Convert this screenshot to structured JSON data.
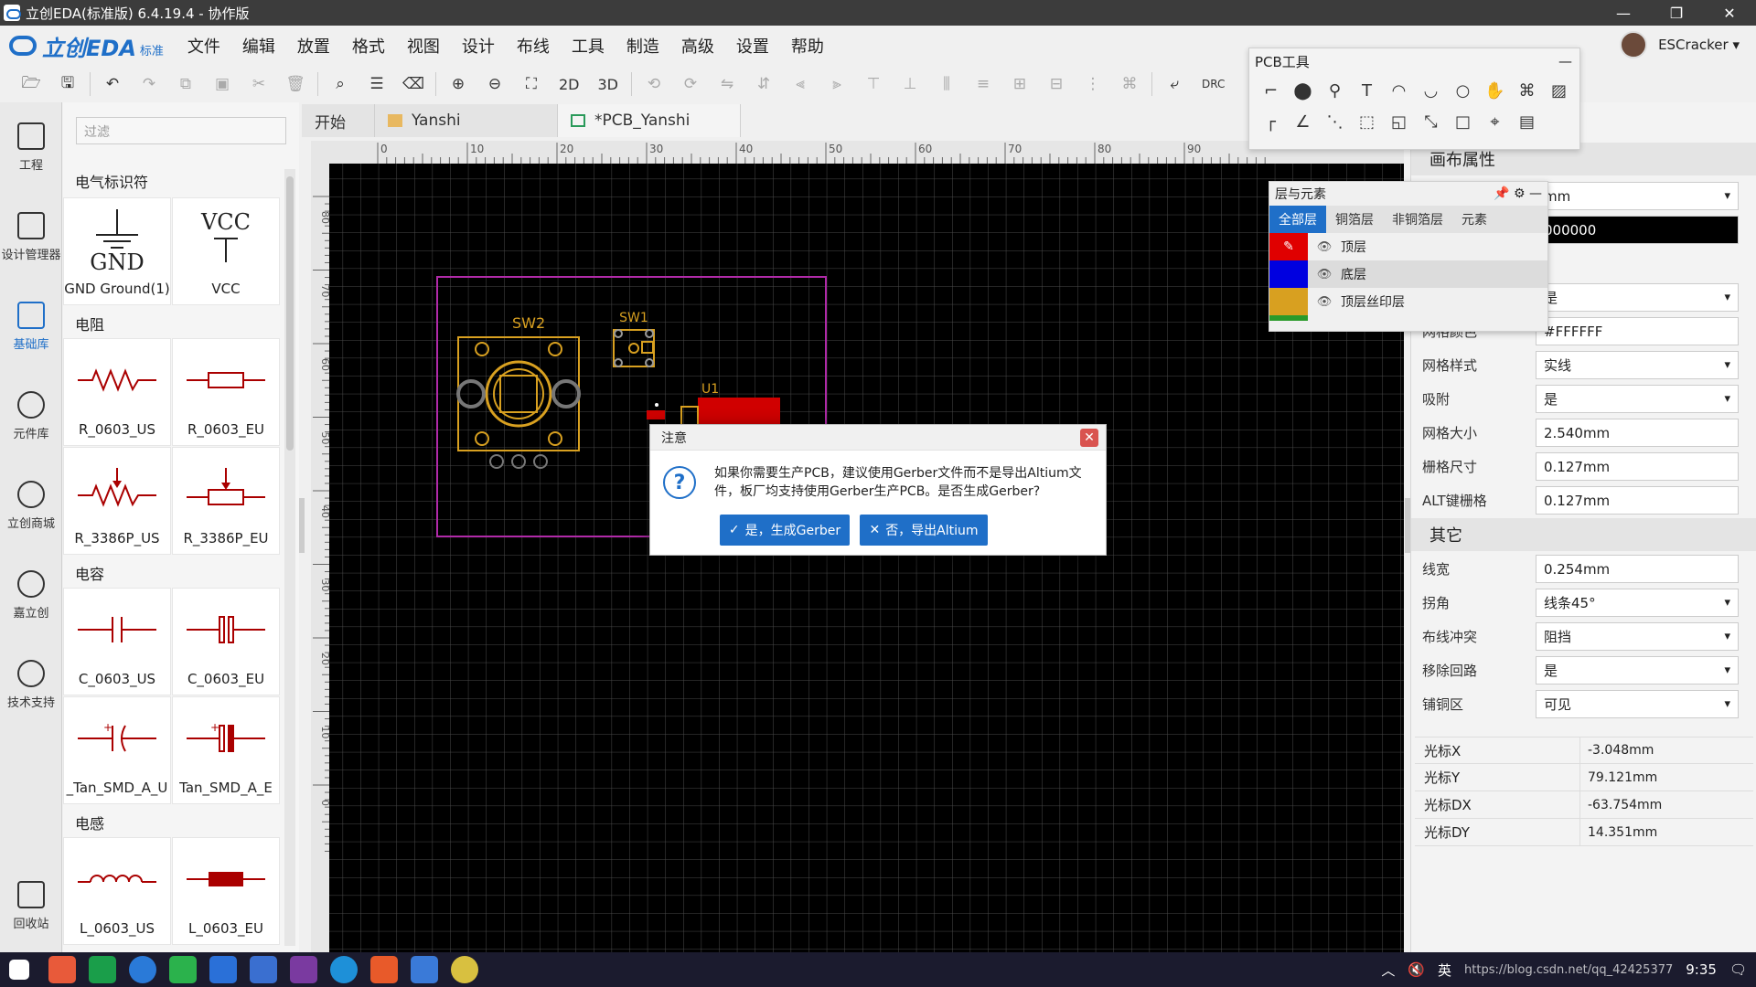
{
  "window": {
    "title": "立创EDA(标准版) 6.4.19.4 - 协作版"
  },
  "logo": {
    "text": "立创EDA",
    "sub": "标准"
  },
  "menu": [
    "文件",
    "编辑",
    "放置",
    "格式",
    "视图",
    "设计",
    "布线",
    "工具",
    "制造",
    "高级",
    "设置",
    "帮助"
  ],
  "user": {
    "name": "ESCracker ▾"
  },
  "toolbar": {
    "btn_2d": "2D",
    "btn_3d": "3D",
    "drc": "DRC"
  },
  "leftnav": [
    {
      "label": "工程",
      "icon": "folder-icon"
    },
    {
      "label": "设计管理器",
      "icon": "list-icon"
    },
    {
      "label": "基础库",
      "icon": "chip-icon"
    },
    {
      "label": "元件库",
      "icon": "search-icon"
    },
    {
      "label": "立创商城",
      "icon": "lcsc-icon"
    },
    {
      "label": "嘉立创",
      "icon": "jlc-icon"
    },
    {
      "label": "技术支持",
      "icon": "help-icon"
    },
    {
      "label": "回收站",
      "icon": "trash-icon"
    }
  ],
  "library": {
    "filter_placeholder": "过滤",
    "cat_elec": "电气标识符",
    "cat_res": "电阻",
    "cat_cap": "电容",
    "cat_ind": "电感",
    "gnd_label": "GND Ground(1)",
    "vcc_label": "VCC",
    "r_us": "R_0603_US",
    "r_eu": "R_0603_EU",
    "r_3386_us": "R_3386P_US",
    "r_3386_eu": "R_3386P_EU",
    "c_us": "C_0603_US",
    "c_eu": "C_0603_EU",
    "tan_a": "_Tan_SMD_A_U",
    "tan_b": "Tan_SMD_A_E",
    "l_us": "L_0603_US",
    "l_eu": "L_0603_EU"
  },
  "tabs": [
    {
      "label": "开始"
    },
    {
      "label": "Yanshi"
    },
    {
      "label": "*PCB_Yanshi"
    }
  ],
  "ruler": {
    "h_ticks": [
      "0",
      "10",
      "20",
      "30",
      "40",
      "50",
      "60",
      "70",
      "80",
      "90"
    ],
    "v_ticks": [
      "80",
      "70",
      "60",
      "50",
      "40",
      "30",
      "20",
      "10",
      "0"
    ]
  },
  "pcb": {
    "sw2": "SW2",
    "sw1": "SW1",
    "u1": "U1"
  },
  "pcbtools": {
    "title": "PCB工具",
    "collapse": "—"
  },
  "layers": {
    "title": "层与元素",
    "tabs": [
      "全部层",
      "铜箔层",
      "非铜箔层",
      "元素"
    ],
    "rows": [
      {
        "name": "顶层",
        "color": "#e00000"
      },
      {
        "name": "底层",
        "color": "#0000e0"
      },
      {
        "name": "顶层丝印层",
        "color": "#d8a020"
      }
    ]
  },
  "props": {
    "sec_canvas": "画布属性",
    "unit": "mm",
    "bg": "000000",
    "grid_visible": "是",
    "grid_color_label": "网格颜色",
    "grid_color": "#FFFFFF",
    "grid_style_label": "网格样式",
    "grid_style": "实线",
    "snap_label": "吸附",
    "snap": "是",
    "grid_size_label": "网格大小",
    "grid_size": "2.540mm",
    "grid_step_label": "栅格尺寸",
    "grid_step": "0.127mm",
    "alt_label": "ALT键栅格",
    "alt": "0.127mm",
    "sec_other": "其它",
    "line_w_label": "线宽",
    "line_w": "0.254mm",
    "corner_label": "拐角",
    "corner": "线条45°",
    "conflict_label": "布线冲突",
    "conflict": "阻挡",
    "loop_label": "移除回路",
    "loop": "是",
    "pour_label": "铺铜区",
    "pour": "可见",
    "cursor_x_label": "光标X",
    "cursor_x": "-3.048mm",
    "cursor_y_label": "光标Y",
    "cursor_y": "79.121mm",
    "cursor_dx_label": "光标DX",
    "cursor_dx": "-63.754mm",
    "cursor_dy_label": "光标DY",
    "cursor_dy": "14.351mm"
  },
  "dialog": {
    "title": "注意",
    "message": "如果你需要生产PCB，建议使用Gerber文件而不是导出Altium文件，板厂均支持使用Gerber生产PCB。是否生成Gerber?",
    "yes": "是，生成Gerber",
    "no": "否，导出Altium"
  },
  "tray": {
    "ime": "英",
    "time": "9:35",
    "url": "https://blog.csdn.net/qq_42425377"
  }
}
